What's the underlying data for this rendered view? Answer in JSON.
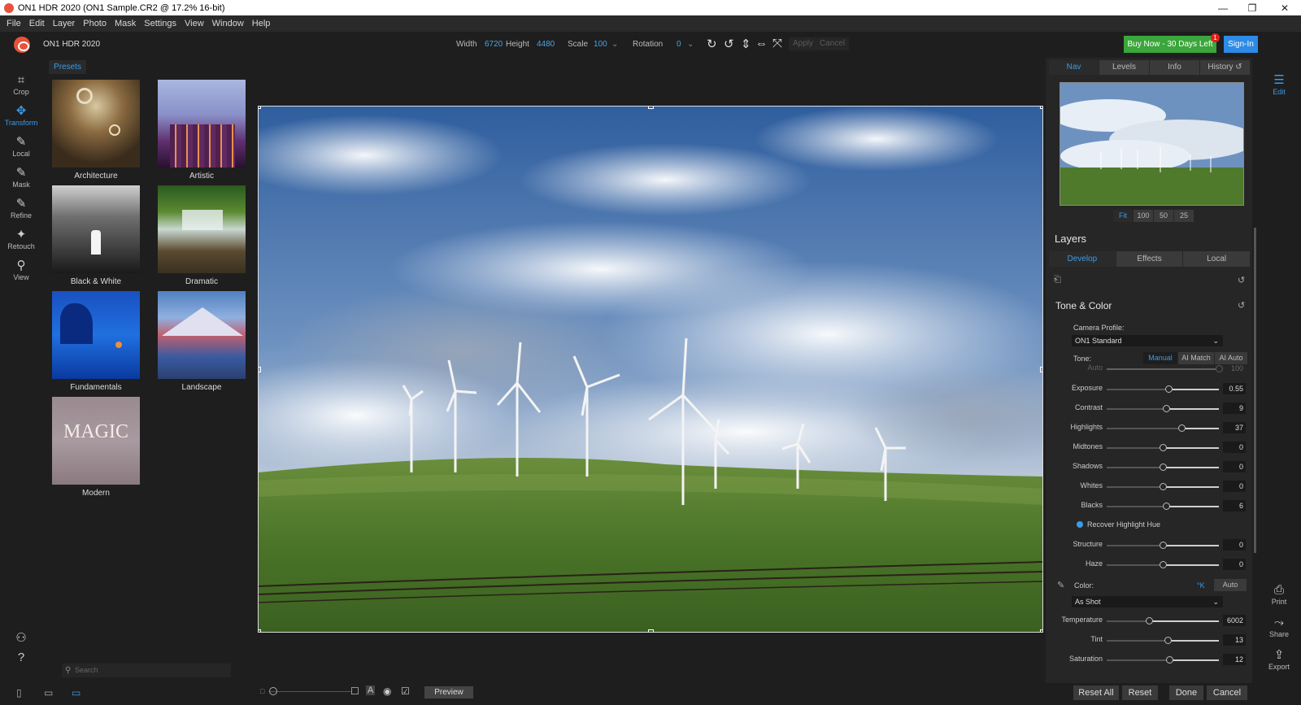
{
  "window": {
    "title": "ON1 HDR 2020 (ON1 Sample.CR2 @ 17.2% 16-bit)",
    "min": "—",
    "max": "❐",
    "close": "✕"
  },
  "menu": [
    "File",
    "Edit",
    "Layer",
    "Photo",
    "Mask",
    "Settings",
    "View",
    "Window",
    "Help"
  ],
  "toolbar": {
    "app_name": "ON1 HDR 2020",
    "width_label": "Width",
    "width_value": "6720",
    "height_label": "Height",
    "height_value": "4480",
    "scale_label": "Scale",
    "scale_value": "100",
    "rotation_label": "Rotation",
    "rotation_value": "0",
    "apply_label": "Apply",
    "cancel_label": "Cancel",
    "buy_label": "Buy Now - 30 Days Left",
    "buy_badge": "1",
    "signin_label": "Sign-In"
  },
  "tools": [
    "Crop",
    "Transform",
    "Local",
    "Mask",
    "Refine",
    "Retouch",
    "View"
  ],
  "presets": {
    "tab_label": "Presets",
    "items": [
      "Architecture",
      "Artistic",
      "Black & White",
      "Dramatic",
      "Fundamentals",
      "Landscape",
      "Modern"
    ],
    "modern_thumb_text": "MAGIC",
    "search_placeholder": "Search"
  },
  "nav": {
    "tabs": [
      "Nav",
      "Levels",
      "Info",
      "History"
    ],
    "zoom": [
      "Fit",
      "100",
      "50",
      "25"
    ]
  },
  "layers": {
    "title": "Layers",
    "tabs": [
      "Develop",
      "Effects",
      "Local"
    ]
  },
  "tone_color": {
    "title": "Tone & Color",
    "camera_profile_label": "Camera Profile:",
    "camera_profile_value": "ON1 Standard",
    "tone_label": "Tone:",
    "tone_modes": [
      "Manual",
      "AI Match",
      "AI Auto"
    ],
    "auto_label": "Auto",
    "auto_value": "100",
    "sliders": [
      {
        "label": "Exposure",
        "value": "0.55",
        "pos": 0.55
      },
      {
        "label": "Contrast",
        "value": "9",
        "pos": 0.53
      },
      {
        "label": "Highlights",
        "value": "37",
        "pos": 0.67
      },
      {
        "label": "Midtones",
        "value": "0",
        "pos": 0.5
      },
      {
        "label": "Shadows",
        "value": "0",
        "pos": 0.5
      },
      {
        "label": "Whites",
        "value": "0",
        "pos": 0.5
      },
      {
        "label": "Blacks",
        "value": "6",
        "pos": 0.53
      }
    ],
    "recover_label": "Recover Highlight Hue",
    "sliders2": [
      {
        "label": "Structure",
        "value": "0",
        "pos": 0.5
      },
      {
        "label": "Haze",
        "value": "0",
        "pos": 0.5
      }
    ],
    "color_label": "Color:",
    "color_k": "°K",
    "color_auto": "Auto",
    "wb_value": "As Shot",
    "sliders3": [
      {
        "label": "Temperature",
        "value": "6002",
        "pos": 0.38
      },
      {
        "label": "Tint",
        "value": "13",
        "pos": 0.54
      },
      {
        "label": "Saturation",
        "value": "12",
        "pos": 0.56
      }
    ]
  },
  "right_tools": [
    "Edit",
    "Print",
    "Share",
    "Export"
  ],
  "bottom": {
    "preview": "Preview",
    "reset_all": "Reset All",
    "reset": "Reset",
    "done": "Done",
    "cancel": "Cancel"
  }
}
